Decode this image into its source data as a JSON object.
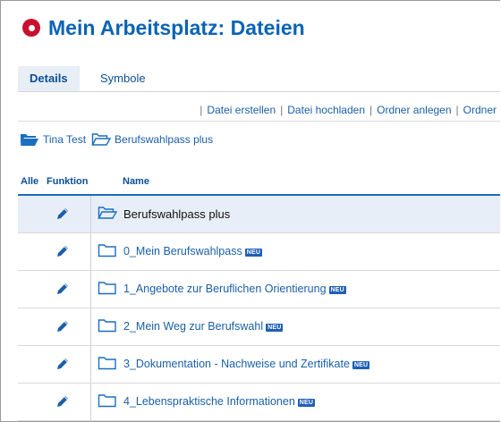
{
  "page": {
    "title": "Mein Arbeitsplatz: Dateien",
    "accent": "#c8102e",
    "brand": "#0a64b4"
  },
  "tabs": [
    {
      "label": "Details",
      "active": true
    },
    {
      "label": "Symbole",
      "active": false
    }
  ],
  "actions": [
    "Datei erstellen",
    "Datei hochladen",
    "Ordner anlegen",
    "Ordner"
  ],
  "breadcrumb": [
    {
      "label": "Tina Test",
      "icon": "folder-open-filled-icon"
    },
    {
      "label": "Berufswahlpass plus",
      "icon": "folder-open-outline-icon"
    }
  ],
  "table": {
    "headers": {
      "all": "Alle",
      "function": "Funktion",
      "name": "Name"
    },
    "parent": {
      "name": "Berufswahlpass plus",
      "icon": "folder-open-icon"
    },
    "rows": [
      {
        "name": "0_Mein Berufswahlpass",
        "badge": "NEU"
      },
      {
        "name": "1_Angebote zur Beruflichen Orientierung",
        "badge": "NEU"
      },
      {
        "name": "2_Mein Weg zur Berufswahl",
        "badge": "NEU"
      },
      {
        "name": "3_Dokumentation - Nachweise und Zertifikate",
        "badge": "NEU"
      },
      {
        "name": "4_Lebenspraktische Informationen",
        "badge": "NEU"
      }
    ]
  }
}
